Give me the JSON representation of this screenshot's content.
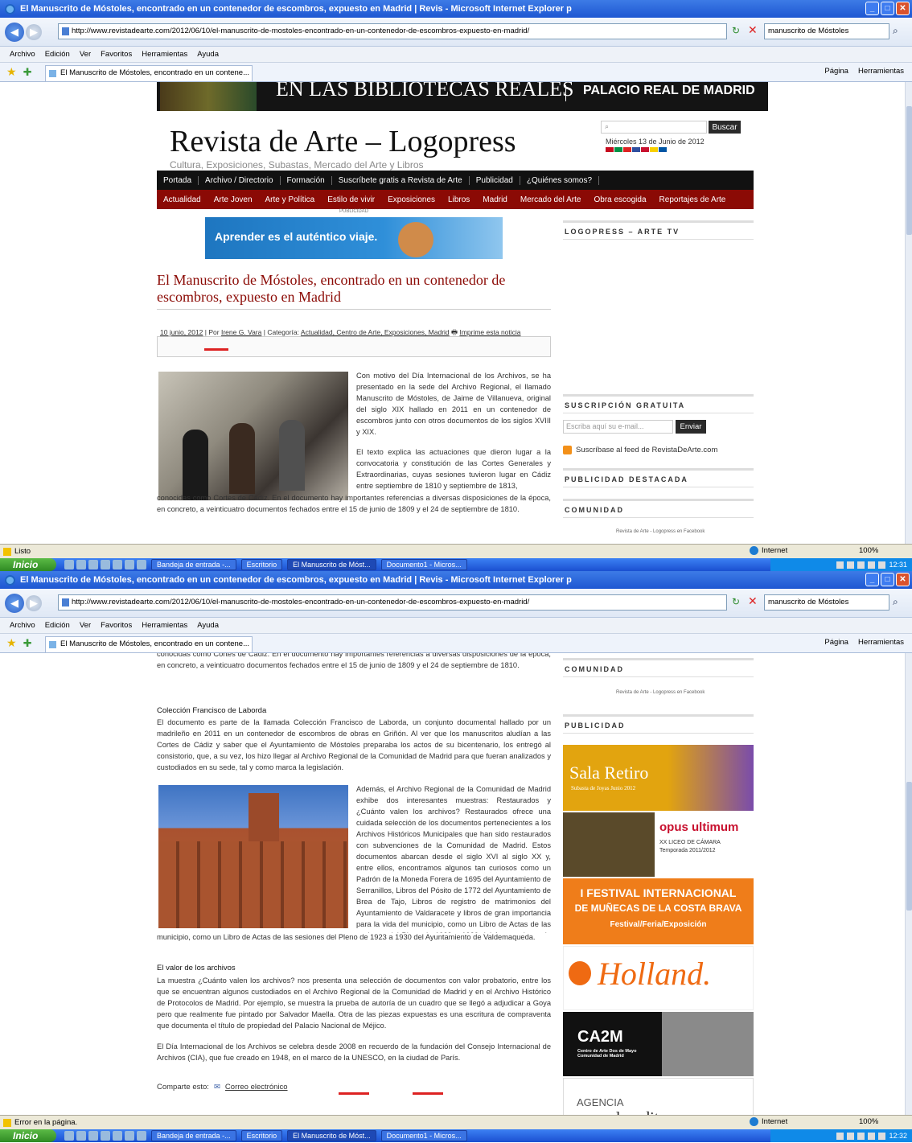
{
  "window": {
    "title": "El Manuscrito de Móstoles, encontrado en un contenedor de escombros, expuesto en Madrid | Revis - Microsoft Internet Explorer p",
    "url": "http://www.revistadearte.com/2012/06/10/el-manuscrito-de-mostoles-encontrado-en-un-contenedor-de-escombros-expuesto-en-madrid/",
    "search_value": "manuscrito de Móstoles",
    "tab_label": "El Manuscrito de Móstoles, encontrado en un contene...",
    "menu": [
      "Archivo",
      "Edición",
      "Ver",
      "Favoritos",
      "Herramientas",
      "Ayuda"
    ],
    "tools": [
      "Página",
      "Herramientas"
    ],
    "zone": "Internet",
    "zoom": "100%",
    "status1": "Listo",
    "status2": "Error en la página.",
    "clock1": "12:31",
    "clock2": "12:32",
    "start": "Inicio",
    "tasks": [
      "Bandeja de entrada -...",
      "Escritorio",
      "El Manuscrito de Móst...",
      "Documento1 - Micros..."
    ]
  },
  "site": {
    "banner_left": "EN LAS BIBLIOTECAS REALES",
    "banner_right": "PALACIO REAL DE MADRID",
    "logo": "Revista de Arte – Logopress",
    "tagline": "Cultura, Exposiciones, Subastas, Mercado del Arte y Libros",
    "search_btn": "Buscar",
    "date": "Miércoles 13 de Junio de 2012",
    "nav_primary": [
      "Portada",
      "Archivo / Directorio",
      "Formación",
      "Suscríbete gratis a Revista de Arte",
      "Publicidad",
      "¿Quiénes somos?"
    ],
    "nav_secondary": [
      "Actualidad",
      "Arte Joven",
      "Arte y Política",
      "Estilo de vivir",
      "Exposiciones",
      "Libros",
      "Madrid",
      "Mercado del Arte",
      "Obra escogida",
      "Reportajes de Arte"
    ],
    "ad_label": "PUBLICIDAD",
    "ad_text": "Aprender es el auténtico viaje."
  },
  "article": {
    "title": "El Manuscrito de Móstoles, encontrado en un contenedor de escombros, expuesto en Madrid",
    "meta_date": "10 junio, 2012",
    "meta_by": "| Por",
    "meta_author": "Irene G. Vara",
    "meta_cat": "| Categoría:",
    "meta_cats": "Actualidad, Centro de Arte, Exposiciones, Madrid",
    "meta_print": "Imprime esta noticia",
    "p1": "Con motivo del Día Internacional de los Archivos, se ha presentado en la sede del Archivo Regional, el llamado Manuscrito de Móstoles, de Jaime de Villanueva, original del siglo XIX hallado en 2011 en un contenedor de escombros junto con otros documentos de los siglos XVIII y XIX.",
    "p2": "El texto explica las actuaciones que dieron lugar a la convocatoria y constitución de las Cortes Generales y Extraordinarias, cuyas sesiones tuvieron lugar en Cádiz entre septiembre de 1810 y septiembre de 1813, conocidas como Cortes de Cádiz. En el documento hay importantes referencias a diversas disposiciones de la época, en concreto, a veinticuatro documentos fechados entre el 15 de junio de 1809 y el 24 de septiembre de 1810.",
    "p2_tail": "conocidas como Cortes de Cádiz. En el documento hay importantes referencias a diversas disposiciones de la época, en concreto, a veinticuatro documentos fechados entre el 15 de junio de 1809 y el 24 de septiembre de 1810.",
    "h_coleccion": "Colección Francisco de Laborda",
    "p3": "El documento es parte de la llamada Colección Francisco de Laborda, un conjunto documental hallado por un madrileño en 2011 en un contenedor de escombros de obras en Griñón. Al ver que los manuscritos aludían a las Cortes de Cádiz y saber que el Ayuntamiento de Móstoles preparaba los actos de su bicentenario, los entregó al consistorio, que, a su vez, los hizo llegar al Archivo Regional de la Comunidad de Madrid para que fueran analizados y custodiados en su sede, tal y como marca la legislación.",
    "p4": "Además, el Archivo Regional de la Comunidad de Madrid exhibe dos interesantes muestras: Restaurados y ¿Cuánto valen los archivos? Restaurados ofrece una cuidada selección de los documentos pertenecientes a los Archivos Históricos Municipales que han sido restaurados con subvenciones de la Comunidad de Madrid. Estos documentos abarcan desde el siglo XVI al siglo XX y, entre ellos, encontramos algunos tan curiosos como un Padrón de la Moneda Forera de 1695 del Ayuntamiento de Serranillos, Libros del Pósito de 1772 del Ayuntamiento de Brea de Tajo, Libros de registro de matrimonios del Ayuntamiento de Valdaracete y libros de gran importancia para la vida del municipio, como un Libro de Actas de las sesiones del Pleno de 1923 a 1930 del Ayuntamiento de Valdemaqueda.",
    "h_valor": "El valor de los archivos",
    "p5": "La muestra ¿Cuánto valen los archivos? nos presenta una selección de documentos con valor probatorio, entre los que se encuentran algunos custodiados en el Archivo Regional de la Comunidad de Madrid y en el Archivo Histórico de Protocolos de Madrid. Por ejemplo, se muestra la prueba de autoría de un cuadro que se llegó a adjudicar a Goya pero que realmente fue pintado por Salvador Maella. Otra de las piezas expuestas es una escritura de compraventa que documenta el título de propiedad del Palacio Nacional de Méjico.",
    "p6": "El Día Internacional de los Archivos se celebra desde 2008 en recuerdo de la fundación del Consejo Internacional de Archivos (CIA), que fue creado en 1948, en el marco de la UNESCO, en la ciudad de París.",
    "share_label": "Comparte esto:",
    "share_email": "Correo electrónico"
  },
  "sidebar": {
    "tv": "LOGOPRESS – ARTE TV",
    "suscripcion": "SUSCRIPCIÓN GRATUITA",
    "email_placeholder": "Escriba aquí su e-mail...",
    "enviar": "Enviar",
    "feed": "Suscríbase al feed de RevistaDeArte.com",
    "pub_destacada": "PUBLICIDAD DESTACADA",
    "comunidad": "COMUNIDAD",
    "facebook": "Revista de Arte - Logopress en Facebook",
    "publicidad": "PUBLICIDAD",
    "ads": {
      "sala_title": "Sala Retiro",
      "sala_sub": "Subasta de Joyas Junio 2012",
      "opus_title": "opus ultimum",
      "opus_sub1": "XX LICEO DE CÁMARA",
      "opus_sub2": "Temporada 2011/2012",
      "festival_l1": "I FESTIVAL INTERNACIONAL",
      "festival_l2": "DE MUÑECAS DE LA COSTA BRAVA",
      "festival_l3": "Festival/Feria/Exposición",
      "holland": "Holland.",
      "ca2m": "CA2M",
      "ca2m_sub": "Centro de Arte Dos de Mayo Comunidad de Madrid",
      "agencia": "AGENCIA",
      "enlace": "enlaceditor"
    }
  }
}
